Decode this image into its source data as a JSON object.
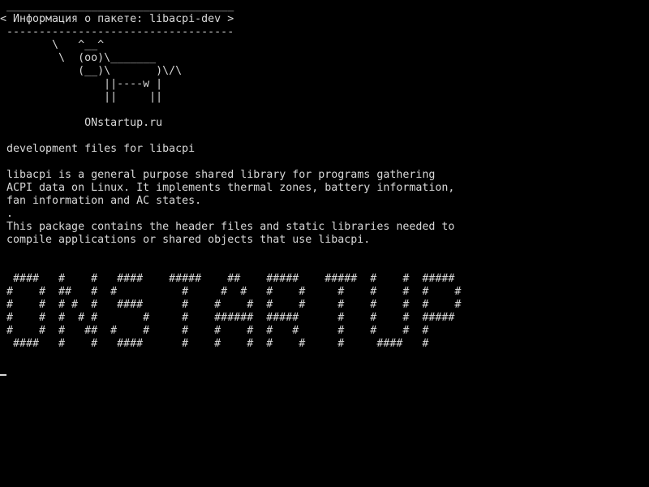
{
  "terminal": {
    "lines": [
      " ___________________________________",
      "< Информация о пакете: libacpi-dev >",
      " -----------------------------------",
      "        \\   ^__^",
      "         \\  (oo)\\_______",
      "            (__)\\       )\\/\\",
      "                ||----w |",
      "                ||     ||",
      "",
      "             ONstartup.ru",
      "",
      " development files for libacpi",
      "",
      " libacpi is a general purpose shared library for programs gathering",
      " ACPI data on Linux. It implements thermal zones, battery information,",
      " fan information and AC states.",
      " .",
      " This package contains the header files and static libraries needed to",
      " compile applications or shared objects that use libacpi.",
      "",
      "",
      "  ####   #    #   ####    #####    ##    #####    #####  #    #  #####",
      " #    #  ##   #  #          #     #  #   #    #     #    #    #  #    #",
      " #    #  # #  #   ####      #    #    #  #    #     #    #    #  #    #",
      " #    #  #  # #       #     #    ######  #####      #    #    #  #####",
      " #    #  #   ##  #    #     #    #    #  #   #      #    #    #  #",
      "  ####   #    #   ####      #    #    #  #    #     #     ####   #"
    ],
    "colors": {
      "background": "#000000",
      "foreground": "#d8d8d8"
    }
  }
}
